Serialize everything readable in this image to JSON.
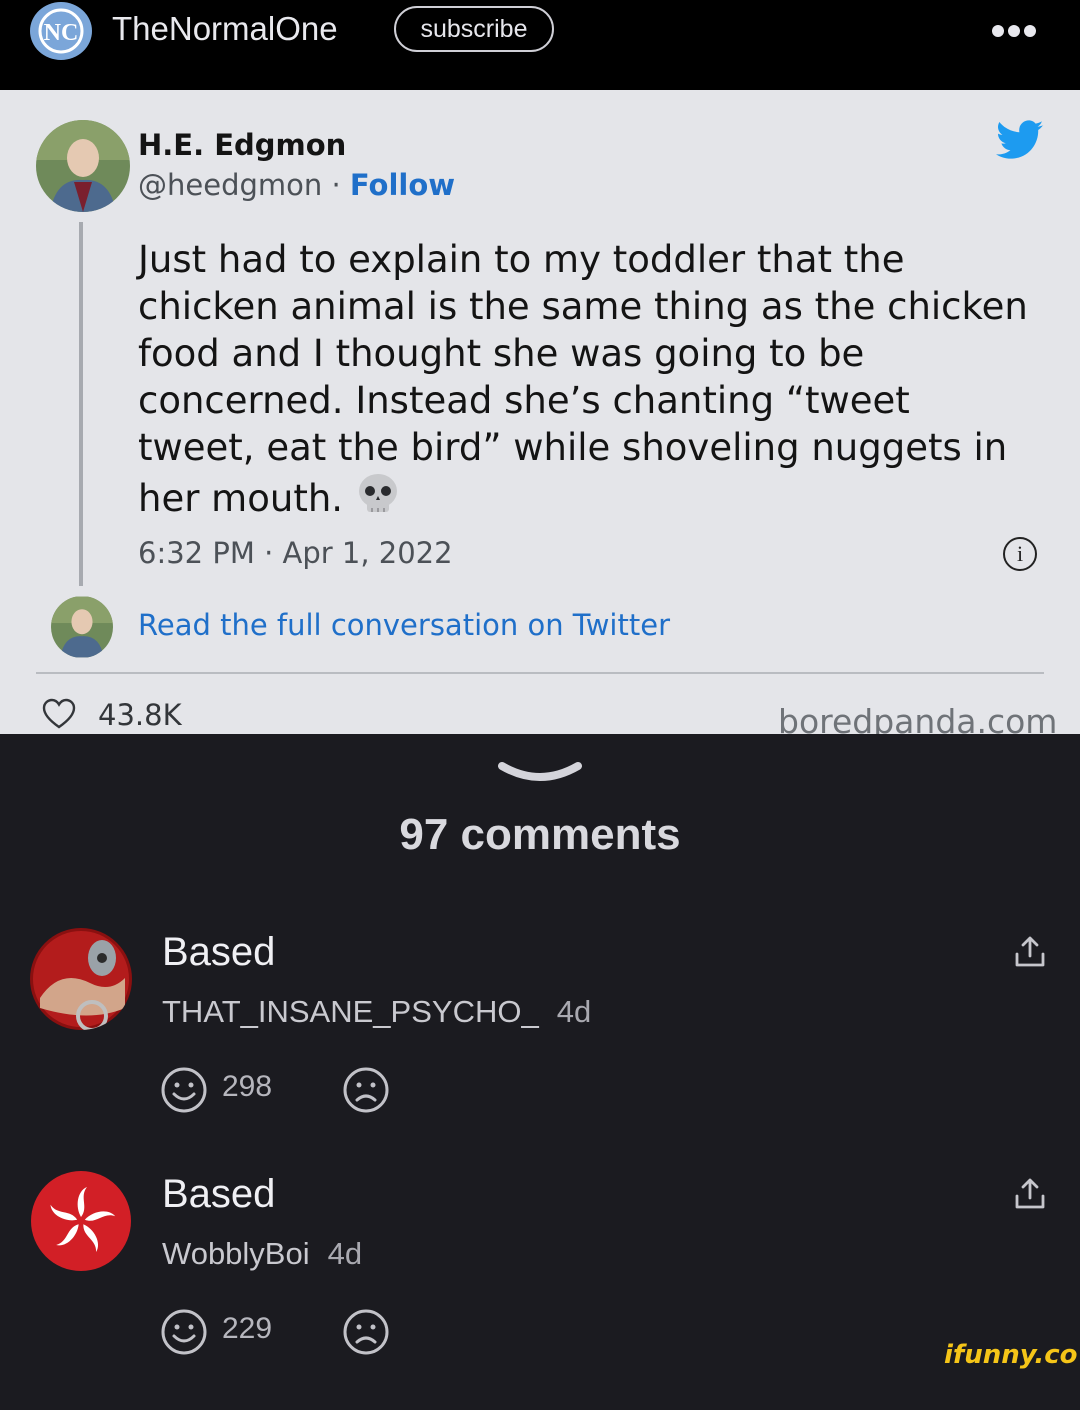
{
  "header": {
    "channel_name": "TheNormalOne",
    "subscribe_label": "subscribe",
    "more_icon": "more-dots-icon"
  },
  "tweet": {
    "author_name": "H.E. Edgmon",
    "handle": "@heedgmon",
    "separator": " · ",
    "follow_label": "Follow",
    "text": "Just had to explain to my toddler that the chicken animal is the same thing as the chicken food and I thought she was going to be concerned. Instead she’s chanting “tweet tweet, eat the bird” while shoveling nuggets in her mouth.",
    "emoji_icon": "skull-icon",
    "timestamp": "6:32 PM · Apr 1, 2022",
    "read_more_label": "Read the full conversation on Twitter",
    "likes": "43.8K",
    "source": "boredpanda.com",
    "colors": {
      "link": "#1f6fc9",
      "card_bg": "#e4e5e9"
    }
  },
  "comments_section": {
    "count_label": "97 comments",
    "comments": [
      {
        "text": "Based",
        "username": "THAT_INSANE_PSYCHO_",
        "age": "4d",
        "score": "298"
      },
      {
        "text": "Based",
        "username": "WobblyBoi",
        "age": "4d",
        "score": "229"
      }
    ]
  },
  "watermark": "ifunny.co"
}
